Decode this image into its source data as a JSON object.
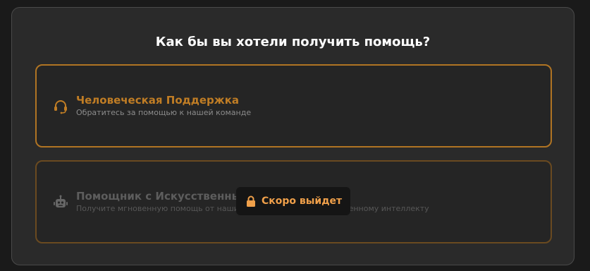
{
  "dialog": {
    "title": "Как бы вы хотели получить помощь?"
  },
  "options": [
    {
      "title": "Человеческая Поддержка",
      "description": "Обратитесь за помощью к нашей команде",
      "icon": "headset-icon",
      "accent_color": "#b07423"
    },
    {
      "title": "Помощник с Искусственным Интеллектом",
      "description": "Получите мгновенную помощь от наших помощников по искусственному интеллекту",
      "icon": "robot-icon",
      "disabled": true
    }
  ],
  "coming_soon_badge": {
    "label": "Скоро выйдет",
    "icon": "lock-icon",
    "color": "#f0a04a"
  }
}
